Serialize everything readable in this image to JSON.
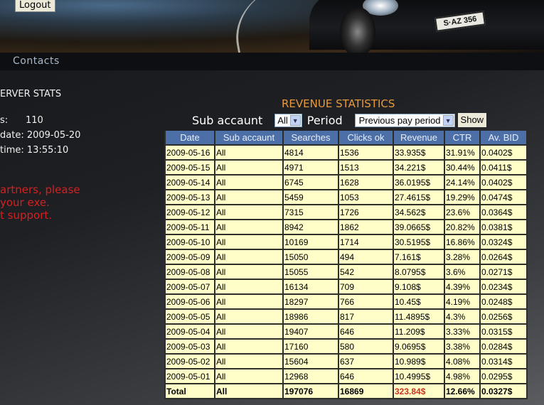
{
  "header": {
    "logout_label": "Logout",
    "plate": "S·AZ 356"
  },
  "nav": {
    "contacts": "Contacts"
  },
  "server_stats": {
    "title": "ERVER STATS",
    "lines": [
      {
        "label": "s:",
        "value": "110"
      },
      {
        "label": "date:",
        "value": "2009-05-20"
      },
      {
        "label": "time:",
        "value": "13:55:10"
      }
    ]
  },
  "notice": [
    "artners, please",
    "your exe.",
    "t support."
  ],
  "revenue": {
    "title": "REVENUE STATISTICS",
    "sub_label": "Sub accaunt",
    "sub_value": "All",
    "period_label": "Period",
    "period_value": "Previous pay period",
    "show_label": "Show",
    "columns": [
      "Date",
      "Sub accaunt",
      "Searches",
      "Clicks ok",
      "Revenue",
      "CTR",
      "Av. BID"
    ],
    "rows": [
      [
        "2009-05-16",
        "All",
        "4814",
        "1536",
        "33.935$",
        "31.91%",
        "0.0402$"
      ],
      [
        "2009-05-15",
        "All",
        "4971",
        "1513",
        "34.221$",
        "30.44%",
        "0.0411$"
      ],
      [
        "2009-05-14",
        "All",
        "6745",
        "1628",
        "36.0195$",
        "24.14%",
        "0.0402$"
      ],
      [
        "2009-05-13",
        "All",
        "5459",
        "1053",
        "27.4615$",
        "19.29%",
        "0.0474$"
      ],
      [
        "2009-05-12",
        "All",
        "7315",
        "1726",
        "34.562$",
        "23.6%",
        "0.0364$"
      ],
      [
        "2009-05-11",
        "All",
        "8942",
        "1862",
        "39.0665$",
        "20.82%",
        "0.0381$"
      ],
      [
        "2009-05-10",
        "All",
        "10169",
        "1714",
        "30.5195$",
        "16.86%",
        "0.0324$"
      ],
      [
        "2009-05-09",
        "All",
        "15050",
        "494",
        "7.161$",
        "3.28%",
        "0.0264$"
      ],
      [
        "2009-05-08",
        "All",
        "15055",
        "542",
        "8.0795$",
        "3.6%",
        "0.0271$"
      ],
      [
        "2009-05-07",
        "All",
        "16134",
        "709",
        "9.108$",
        "4.39%",
        "0.0234$"
      ],
      [
        "2009-05-06",
        "All",
        "18297",
        "766",
        "10.45$",
        "4.19%",
        "0.0248$"
      ],
      [
        "2009-05-05",
        "All",
        "18986",
        "817",
        "11.4895$",
        "4.3%",
        "0.0256$"
      ],
      [
        "2009-05-04",
        "All",
        "19407",
        "646",
        "11.209$",
        "3.33%",
        "0.0315$"
      ],
      [
        "2009-05-03",
        "All",
        "17160",
        "580",
        "9.0695$",
        "3.38%",
        "0.0284$"
      ],
      [
        "2009-05-02",
        "All",
        "15604",
        "637",
        "10.989$",
        "4.08%",
        "0.0314$"
      ],
      [
        "2009-05-01",
        "All",
        "12968",
        "646",
        "10.4995$",
        "4.98%",
        "0.0295$"
      ]
    ],
    "total": [
      "Total",
      "All",
      "197076",
      "16869",
      "323.84$",
      "12.66%",
      "0.0327$"
    ]
  }
}
